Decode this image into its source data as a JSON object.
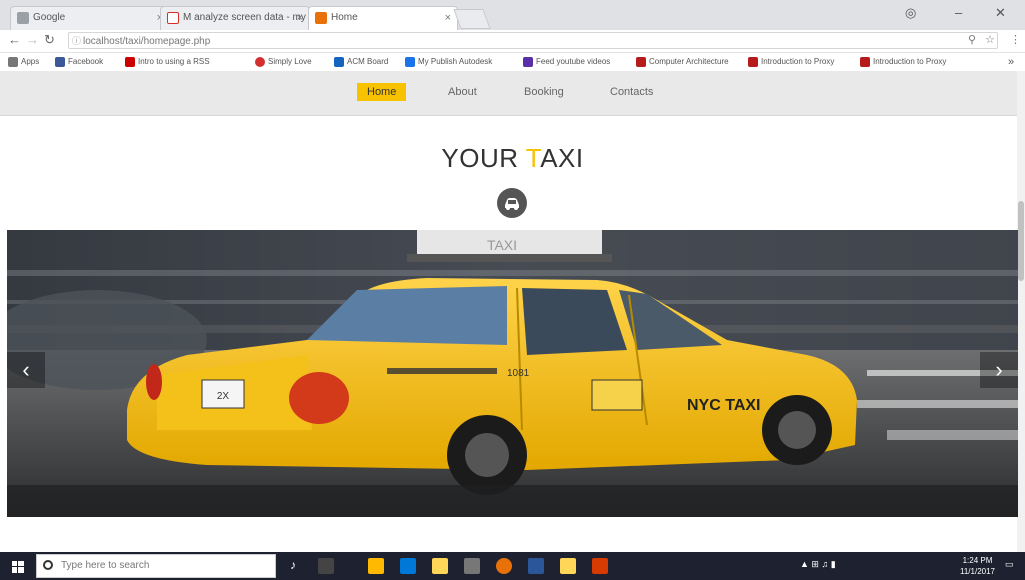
{
  "browser": {
    "tabs": [
      {
        "label": "Google ",
        "favicon_color": "#8a8a8a"
      },
      {
        "label": "M analyze screen data - my ",
        "favicon_color": "#d93025"
      },
      {
        "label": "Home",
        "favicon_color": "#e8710a"
      }
    ],
    "address": "localhost/taxi/homepage.php",
    "bookmarks": [
      {
        "label": "Apps",
        "color": "#777"
      },
      {
        "label": "Facebook",
        "color": "#3b5998"
      },
      {
        "label": "Intro to using a RSS",
        "color": "#cc0000"
      },
      {
        "label": "Simply Love",
        "color": "#d32f2f"
      },
      {
        "label": "ACM Board",
        "color": "#1565c0"
      },
      {
        "label": "My Publish Autodesk",
        "color": "#1a73e8"
      },
      {
        "label": "Feed youtube videos",
        "color": "#5a2ea6"
      },
      {
        "label": "Computer Architecture",
        "color": "#b71c1c"
      },
      {
        "label": "Introduction to Proxy",
        "color": "#b71c1c"
      },
      {
        "label": "Introduction to Proxy",
        "color": "#b71c1c"
      }
    ]
  },
  "site": {
    "nav": [
      "Home",
      "About",
      "Booking",
      "Contacts"
    ],
    "brand_main": "YOUR ",
    "brand_accent": "T",
    "brand_rest": "AXI",
    "accent_color": "#f7c300",
    "taxi_sign": "TAXI",
    "taxi_logo": "NYC TAXI",
    "taxi_number": "1081",
    "plate": "2X"
  },
  "taskbar": {
    "search_placeholder": "Type here to search",
    "time": "1:24 PM",
    "date": "11/1/2017"
  }
}
